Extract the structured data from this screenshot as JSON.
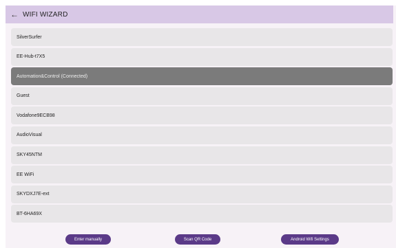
{
  "appbar": {
    "title": "WIFI WIZARD",
    "back_icon": "arrow-left-icon"
  },
  "networks": [
    {
      "name": "SilverSurfer",
      "connected": false
    },
    {
      "name": "EE-Hub-t7X5",
      "connected": false
    },
    {
      "name": "Automation&Control (Connected)",
      "connected": true
    },
    {
      "name": "Guest",
      "connected": false
    },
    {
      "name": "Vodafone9ECB98",
      "connected": false
    },
    {
      "name": "AudioVisual",
      "connected": false
    },
    {
      "name": "SKY45NTM",
      "connected": false
    },
    {
      "name": "EE WiFi",
      "connected": false
    },
    {
      "name": "SKYDXJ7E-ext",
      "connected": false
    },
    {
      "name": "BT-6HA69X",
      "connected": false
    }
  ],
  "buttons": {
    "enter_manually": "Enter manually",
    "scan_qr": "Scan QR Code",
    "android_settings": "Android Wifi Settings"
  },
  "colors": {
    "appbar": "#d8c8e6",
    "row": "#e8e6e8",
    "row_connected": "#7b7b7b",
    "button": "#5b3a88"
  }
}
